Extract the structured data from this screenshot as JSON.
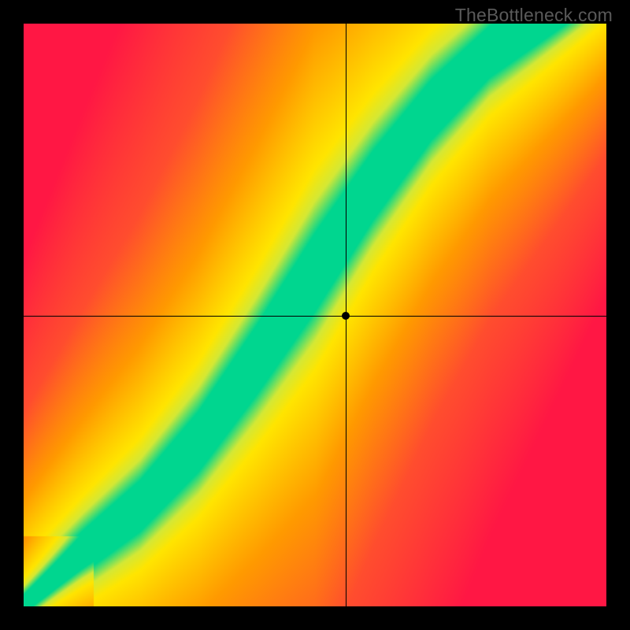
{
  "watermark": "TheBottleneck.com",
  "chart_data": {
    "type": "heatmap",
    "title": "",
    "xlabel": "",
    "ylabel": "",
    "xlim": [
      0,
      1
    ],
    "ylim": [
      0,
      1
    ],
    "crosshair": {
      "x": 0.553,
      "y": 0.499
    },
    "marker": {
      "x": 0.553,
      "y": 0.499
    },
    "optimal_ridge_description": "diagonal green band from lower-left to upper-right, slightly convex, indicating balanced pairing; colors fade through yellow to orange to red away from ridge",
    "optimal_ridge_points": [
      {
        "x": 0.02,
        "y": 0.02
      },
      {
        "x": 0.1,
        "y": 0.09
      },
      {
        "x": 0.2,
        "y": 0.17
      },
      {
        "x": 0.3,
        "y": 0.28
      },
      {
        "x": 0.4,
        "y": 0.42
      },
      {
        "x": 0.5,
        "y": 0.57
      },
      {
        "x": 0.6,
        "y": 0.72
      },
      {
        "x": 0.7,
        "y": 0.85
      },
      {
        "x": 0.8,
        "y": 0.95
      },
      {
        "x": 0.88,
        "y": 1.0
      }
    ],
    "color_scale": [
      {
        "distance": 0.0,
        "color": "#00d68f"
      },
      {
        "distance": 0.05,
        "color": "#00d68f"
      },
      {
        "distance": 0.09,
        "color": "#d4e835"
      },
      {
        "distance": 0.13,
        "color": "#ffe500"
      },
      {
        "distance": 0.3,
        "color": "#ff9a00"
      },
      {
        "distance": 0.55,
        "color": "#ff4d2e"
      },
      {
        "distance": 1.0,
        "color": "#ff1744"
      }
    ],
    "grid": false,
    "legend": false
  }
}
